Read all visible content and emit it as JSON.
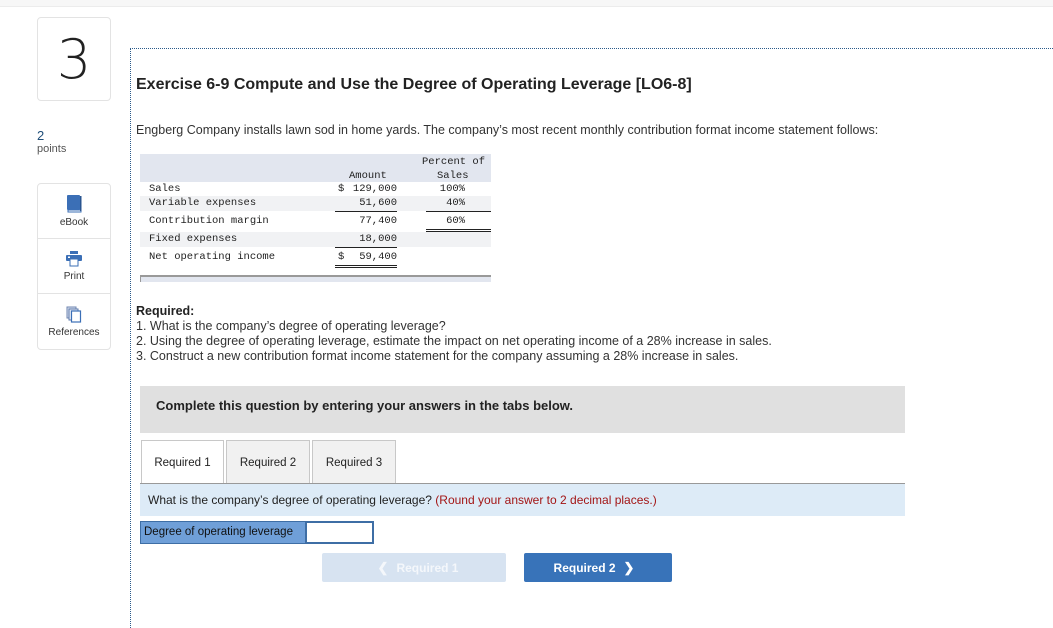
{
  "question": {
    "number": "3",
    "points_value": "2",
    "points_label": "points"
  },
  "tools": [
    {
      "label": "eBook",
      "icon": "book-icon"
    },
    {
      "label": "Print",
      "icon": "printer-icon"
    },
    {
      "label": "References",
      "icon": "copy-pages-icon"
    }
  ],
  "exercise": {
    "title": "Exercise 6-9 Compute and Use the Degree of Operating Leverage [LO6-8]",
    "intro": "Engberg Company installs lawn sod in home yards. The company’s most recent monthly contribution format income statement follows:"
  },
  "statement": {
    "header_amount": "Amount",
    "header_percent_1": "Percent of",
    "header_percent_2": "Sales",
    "rows": [
      {
        "label": "Sales",
        "dollar": "$",
        "amount": "129,000",
        "percent": "100%"
      },
      {
        "label": "Variable expenses",
        "dollar": "",
        "amount": "51,600",
        "percent": "40%"
      },
      {
        "label": "Contribution margin",
        "dollar": "",
        "amount": "77,400",
        "percent": "60%"
      },
      {
        "label": "Fixed expenses",
        "dollar": "",
        "amount": "18,000",
        "percent": ""
      },
      {
        "label": "Net operating income",
        "dollar": "$",
        "amount": "59,400",
        "percent": ""
      }
    ]
  },
  "required": {
    "heading": "Required:",
    "items": [
      "1. What is the company’s degree of operating leverage?",
      "2. Using the degree of operating leverage, estimate the impact on net operating income of a 28% increase in sales.",
      "3. Construct a new contribution format income statement for the company assuming a 28% increase in sales."
    ]
  },
  "instructions": "Complete this question by entering your answers in the tabs below.",
  "tabs": [
    {
      "label": "Required 1",
      "active": true
    },
    {
      "label": "Required 2",
      "active": false
    },
    {
      "label": "Required 3",
      "active": false
    }
  ],
  "prompt": {
    "question": "What is the company’s degree of operating leverage?",
    "hint": "(Round your answer to 2 decimal places.)"
  },
  "answer": {
    "label": "Degree of operating leverage",
    "value": ""
  },
  "navigation": {
    "prev_label": "Required 1",
    "next_label": "Required 2"
  },
  "colors": {
    "accent": "#3873b9",
    "hint": "#a31515",
    "prompt_bg": "#ddebf7",
    "answer_label_bg": "#6f9fd8"
  }
}
